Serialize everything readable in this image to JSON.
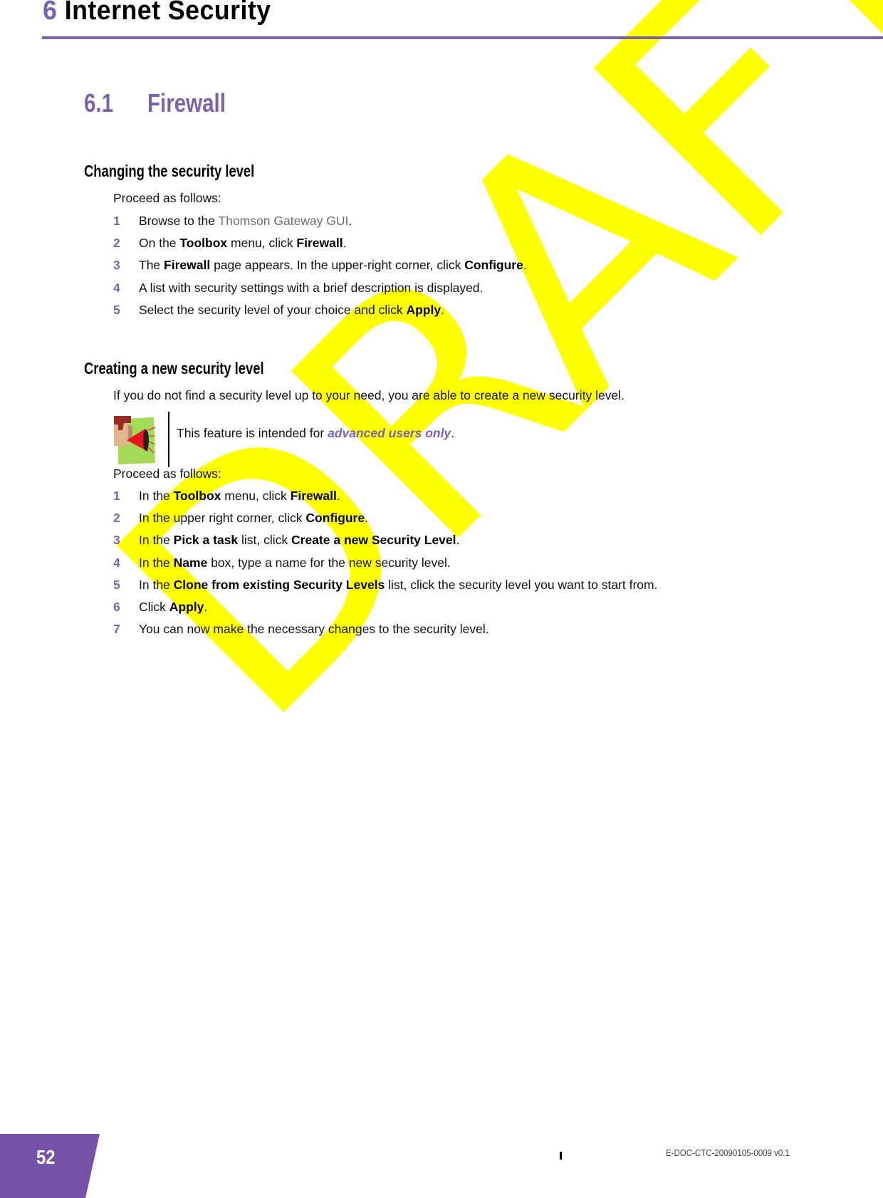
{
  "watermark": {
    "text": "DRAFT",
    "color": "#ffff00"
  },
  "chapter": {
    "number": "6",
    "title": "Internet Security"
  },
  "section": {
    "number": "6.1",
    "title": "Firewall"
  },
  "changing": {
    "heading": "Changing the security level",
    "intro": "Proceed as follows:",
    "steps": [
      {
        "num": "1",
        "parts": [
          {
            "t": "Browse to the "
          },
          {
            "t": "Thomson Gateway GUI",
            "style": "link"
          },
          {
            "t": "."
          }
        ]
      },
      {
        "num": "2",
        "parts": [
          {
            "t": "On the "
          },
          {
            "t": "Toolbox",
            "style": "bold"
          },
          {
            "t": " menu, click "
          },
          {
            "t": "Firewall",
            "style": "bold"
          },
          {
            "t": "."
          }
        ]
      },
      {
        "num": "3",
        "parts": [
          {
            "t": "The "
          },
          {
            "t": "Firewall",
            "style": "bold"
          },
          {
            "t": " page appears. In the upper-right corner, click "
          },
          {
            "t": "Configure",
            "style": "bold"
          },
          {
            "t": "."
          }
        ]
      },
      {
        "num": "4",
        "parts": [
          {
            "t": "A list with security settings with a brief description is displayed."
          }
        ]
      },
      {
        "num": "5",
        "parts": [
          {
            "t": "Select the security level of your choice and click "
          },
          {
            "t": "Apply",
            "style": "bold"
          },
          {
            "t": "."
          }
        ]
      }
    ]
  },
  "creating": {
    "heading": "Creating a new security level",
    "description": "If you do not find a security level up to your need, you are able to create a new security level.",
    "note": {
      "icon": "megaphone-warning-icon",
      "prefix": "This feature is intended for ",
      "emphasis": "advanced users only",
      "suffix": "."
    },
    "intro": "Proceed as follows:",
    "steps": [
      {
        "num": "1",
        "parts": [
          {
            "t": "In the "
          },
          {
            "t": "Toolbox",
            "style": "bold"
          },
          {
            "t": " menu, click "
          },
          {
            "t": "Firewall",
            "style": "bold"
          },
          {
            "t": "."
          }
        ]
      },
      {
        "num": "2",
        "parts": [
          {
            "t": "In the upper right corner, click "
          },
          {
            "t": "Configure",
            "style": "bold"
          },
          {
            "t": "."
          }
        ]
      },
      {
        "num": "3",
        "parts": [
          {
            "t": "In the "
          },
          {
            "t": "Pick a task",
            "style": "bold"
          },
          {
            "t": " list, click "
          },
          {
            "t": "Create a new Security Level",
            "style": "bold"
          },
          {
            "t": "."
          }
        ]
      },
      {
        "num": "4",
        "parts": [
          {
            "t": "In the "
          },
          {
            "t": "Name",
            "style": "bold"
          },
          {
            "t": " box, type a name for the new security level."
          }
        ]
      },
      {
        "num": "5",
        "parts": [
          {
            "t": "In the "
          },
          {
            "t": "Clone from existing Security Levels",
            "style": "bold"
          },
          {
            "t": " list, click the security level you want to start from."
          }
        ]
      },
      {
        "num": "6",
        "parts": [
          {
            "t": "Click "
          },
          {
            "t": "Apply",
            "style": "bold"
          },
          {
            "t": "."
          }
        ]
      },
      {
        "num": "7",
        "parts": [
          {
            "t": "You can now make the necessary changes to the security level."
          }
        ]
      }
    ]
  },
  "footer": {
    "page_number": "52",
    "doc_id": "E-DOC-CTC-20090105-0009 v0.1",
    "accent_color": "#7552a8"
  },
  "colors": {
    "accent": "#7b63ab",
    "link_gray": "#6e6e6e"
  }
}
